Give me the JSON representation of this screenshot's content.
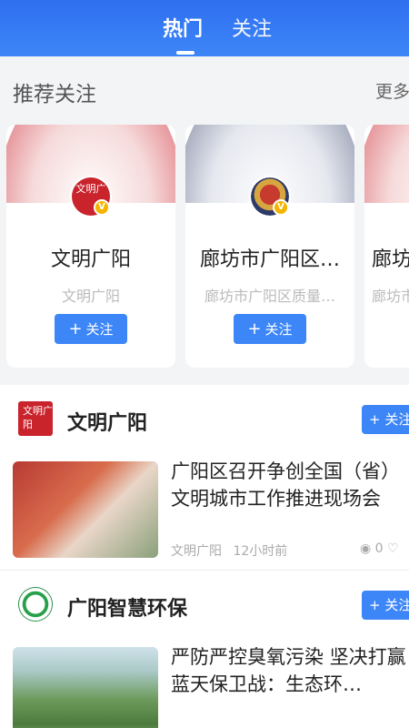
{
  "tabs": {
    "active": "热门",
    "other": "关注"
  },
  "recommend": {
    "title": "推荐关注",
    "more": "更多",
    "cards": [
      {
        "name": "文明广阳",
        "sub": "文明广阳",
        "follow": "关注",
        "avatar_text": "文明广"
      },
      {
        "name": "廊坊市广阳区…",
        "sub": "廊坊市广阳区质量…",
        "follow": "关注"
      },
      {
        "name": "廊坊",
        "sub": "廊坊市"
      }
    ],
    "badge": "V"
  },
  "feed": [
    {
      "source": "文明广阳",
      "source_logo_text": "文明广阳",
      "follow": "关注",
      "title": "广阳区召开争创全国（省）文明城市工作推进现场会",
      "meta_source": "文明广阳",
      "time": "12小时前",
      "views": "0"
    },
    {
      "source": "广阳智慧环保",
      "follow": "关注",
      "title": "严防严控臭氧污染 坚决打赢蓝天保卫战：生态环…"
    }
  ],
  "colors": {
    "primary": "#3d86f7",
    "header": "#2f6ff0"
  }
}
